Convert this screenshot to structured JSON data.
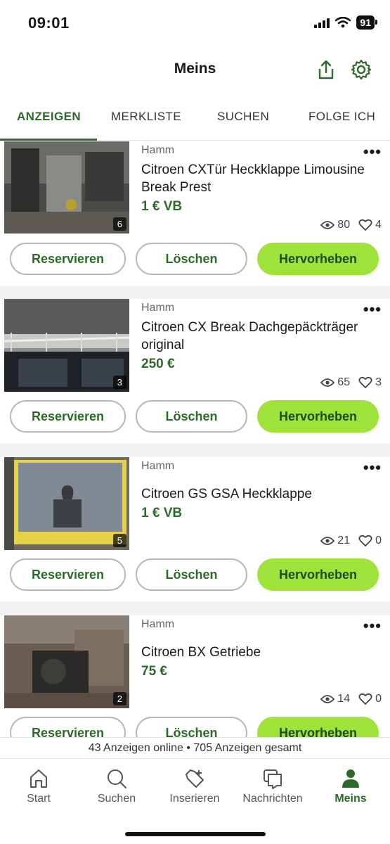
{
  "status": {
    "time": "09:01",
    "battery": "91"
  },
  "header": {
    "title": "Meins",
    "share_icon": "share-icon",
    "settings_icon": "gear-icon"
  },
  "tabs": [
    {
      "label": "ANZEIGEN",
      "active": true
    },
    {
      "label": "MERKLISTE",
      "active": false
    },
    {
      "label": "SUCHEN",
      "active": false
    },
    {
      "label": "FOLGE ICH",
      "active": false
    }
  ],
  "listings": [
    {
      "location": "Hamm",
      "title": "Citroen CXTür Heckklappe Limousine Break Prest",
      "price": "1 € VB",
      "photos": "6",
      "views": "80",
      "likes": "4"
    },
    {
      "location": "Hamm",
      "title": "Citroen CX Break Dachgepäckträger original",
      "price": "250 €",
      "photos": "3",
      "views": "65",
      "likes": "3"
    },
    {
      "location": "Hamm",
      "title": "Citroen GS GSA Heckklappe",
      "price": "1 € VB",
      "photos": "5",
      "views": "21",
      "likes": "0"
    },
    {
      "location": "Hamm",
      "title": "Citroen BX Getriebe",
      "price": "75 €",
      "photos": "2",
      "views": "14",
      "likes": "0"
    }
  ],
  "actions": {
    "reserve": "Reservieren",
    "delete": "Löschen",
    "highlight": "Hervorheben",
    "more": "•••"
  },
  "footer": {
    "summary": "43 Anzeigen online • 705 Anzeigen gesamt"
  },
  "nav": [
    {
      "label": "Start",
      "icon": "home-icon"
    },
    {
      "label": "Suchen",
      "icon": "search-icon"
    },
    {
      "label": "Inserieren",
      "icon": "tag-plus-icon"
    },
    {
      "label": "Nachrichten",
      "icon": "messages-icon"
    },
    {
      "label": "Meins",
      "icon": "person-icon",
      "active": true
    }
  ],
  "colors": {
    "brand": "#2d6a2a",
    "accent": "#9ee23a"
  }
}
